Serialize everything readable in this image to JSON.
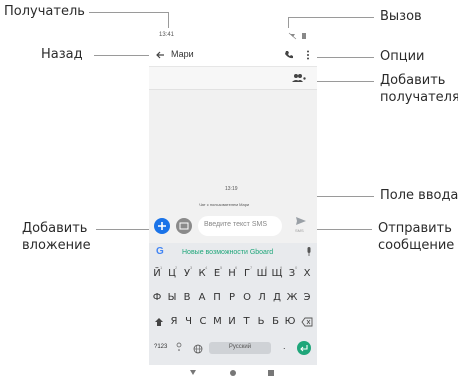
{
  "callouts": {
    "recipient": "Получатель",
    "back": "Назад",
    "call": "Вызов",
    "options": "Опции",
    "add_recipient_1": "Добавить",
    "add_recipient_2": "получателя",
    "input_field": "Поле ввода",
    "attach_1": "Добавить",
    "attach_2": "вложение",
    "send_1": "Отправить",
    "send_2": "сообщение"
  },
  "phone": {
    "status_time": "13:41",
    "contact_name": "Мари",
    "conversation_time": "13:19",
    "chat_with_note": "Чат с пользователем Мари",
    "composer_placeholder": "Введите текст SMS",
    "send_label": "SMS",
    "suggestion_text": "Новые возможности Gboard",
    "language_label": "Русский",
    "symbols_key": "?123"
  },
  "keyboard": {
    "row1": [
      "Й",
      "Ц",
      "У",
      "К",
      "Е",
      "Н",
      "Г",
      "Ш",
      "Щ",
      "З",
      "Х"
    ],
    "row1_nums": [
      "1",
      "2",
      "3",
      "4",
      "5",
      "6",
      "7",
      "8",
      "9",
      "0",
      ""
    ],
    "row2": [
      "Ф",
      "Ы",
      "В",
      "А",
      "П",
      "Р",
      "О",
      "Л",
      "Д",
      "Ж",
      "Э"
    ],
    "row3": [
      "Я",
      "Ч",
      "С",
      "М",
      "И",
      "Т",
      "Ь",
      "Б",
      "Ю"
    ]
  },
  "icons": {
    "back": "arrow-left-icon",
    "call": "phone-icon",
    "options": "more-vert-icon",
    "add_recipient": "group-add-icon",
    "attach": "plus-icon",
    "gallery": "gallery-icon",
    "send": "send-icon",
    "google": "google-g-icon",
    "mic": "mic-icon",
    "shift": "shift-icon",
    "backspace": "backspace-icon",
    "emoji": "emoji-icon",
    "globe": "globe-icon",
    "enter": "enter-icon"
  },
  "colors": {
    "accent_blue": "#1a73e8",
    "enter_green": "#1fa67a"
  }
}
